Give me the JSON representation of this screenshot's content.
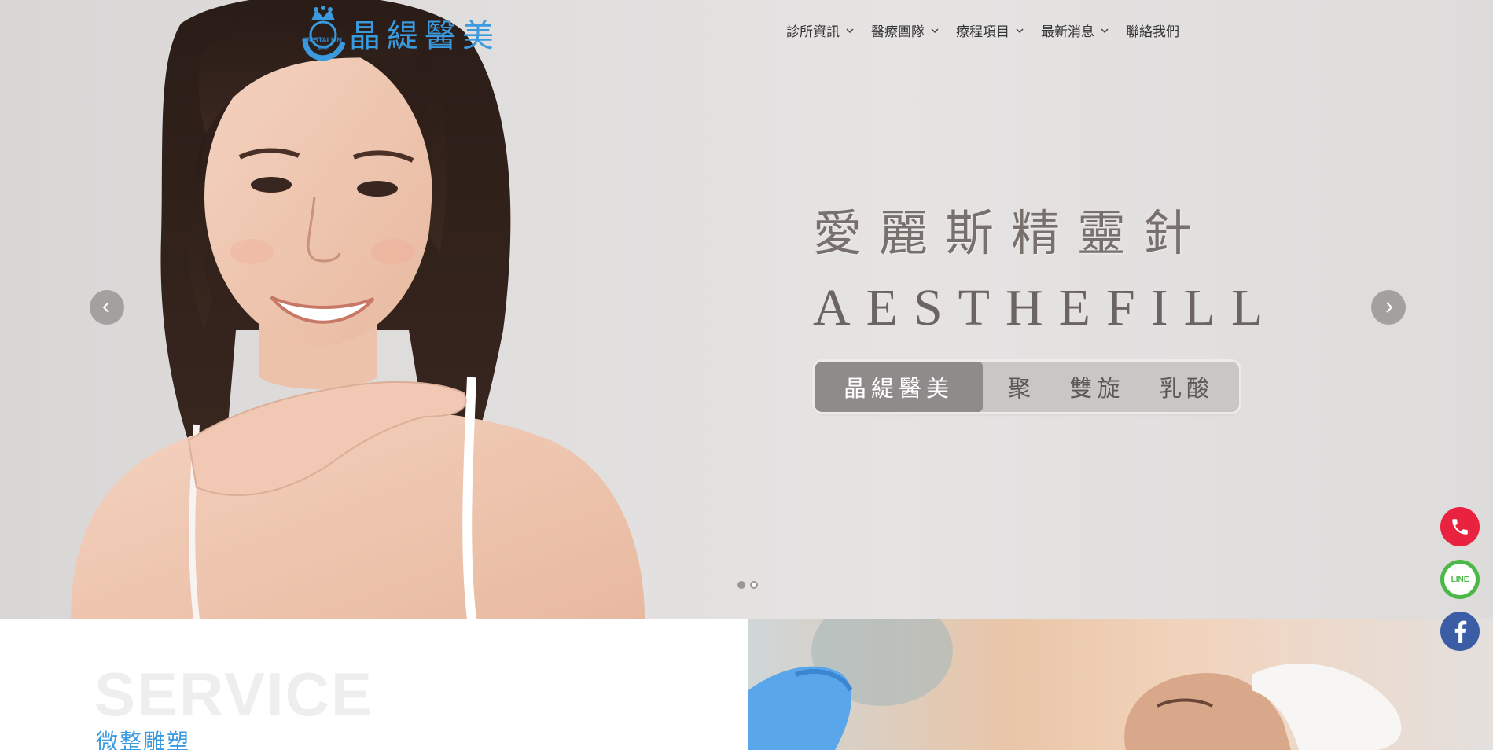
{
  "header": {
    "logo_text": "晶緹醫美",
    "logo_mark_text": "CRISTALLIN",
    "logo_mark_sub": "醫美"
  },
  "nav": {
    "items": [
      {
        "label": "診所資訊",
        "has_dropdown": true
      },
      {
        "label": "醫療團隊",
        "has_dropdown": true
      },
      {
        "label": "療程項目",
        "has_dropdown": true
      },
      {
        "label": "最新消息",
        "has_dropdown": true
      },
      {
        "label": "聯絡我們",
        "has_dropdown": false
      }
    ]
  },
  "hero": {
    "title_zh": "愛麗斯精靈針",
    "title_en": "AESTHEFILL",
    "pill_left": "晶緹醫美",
    "pill_right": [
      "聚",
      "雙旋",
      "乳酸"
    ],
    "prev_icon": "chevron-left-icon",
    "next_icon": "chevron-right-icon",
    "slides": 2,
    "active_slide": 1
  },
  "service": {
    "title_en": "SERVICE",
    "title_zh": "微整雕塑"
  },
  "social": {
    "phone_icon": "phone-icon",
    "line_label": "LINE",
    "facebook_icon": "facebook-icon"
  },
  "colors": {
    "brand_blue": "#3a9ae0",
    "phone_red": "#e8223f",
    "line_green": "#4cb848",
    "facebook_blue": "#3b5da5"
  }
}
